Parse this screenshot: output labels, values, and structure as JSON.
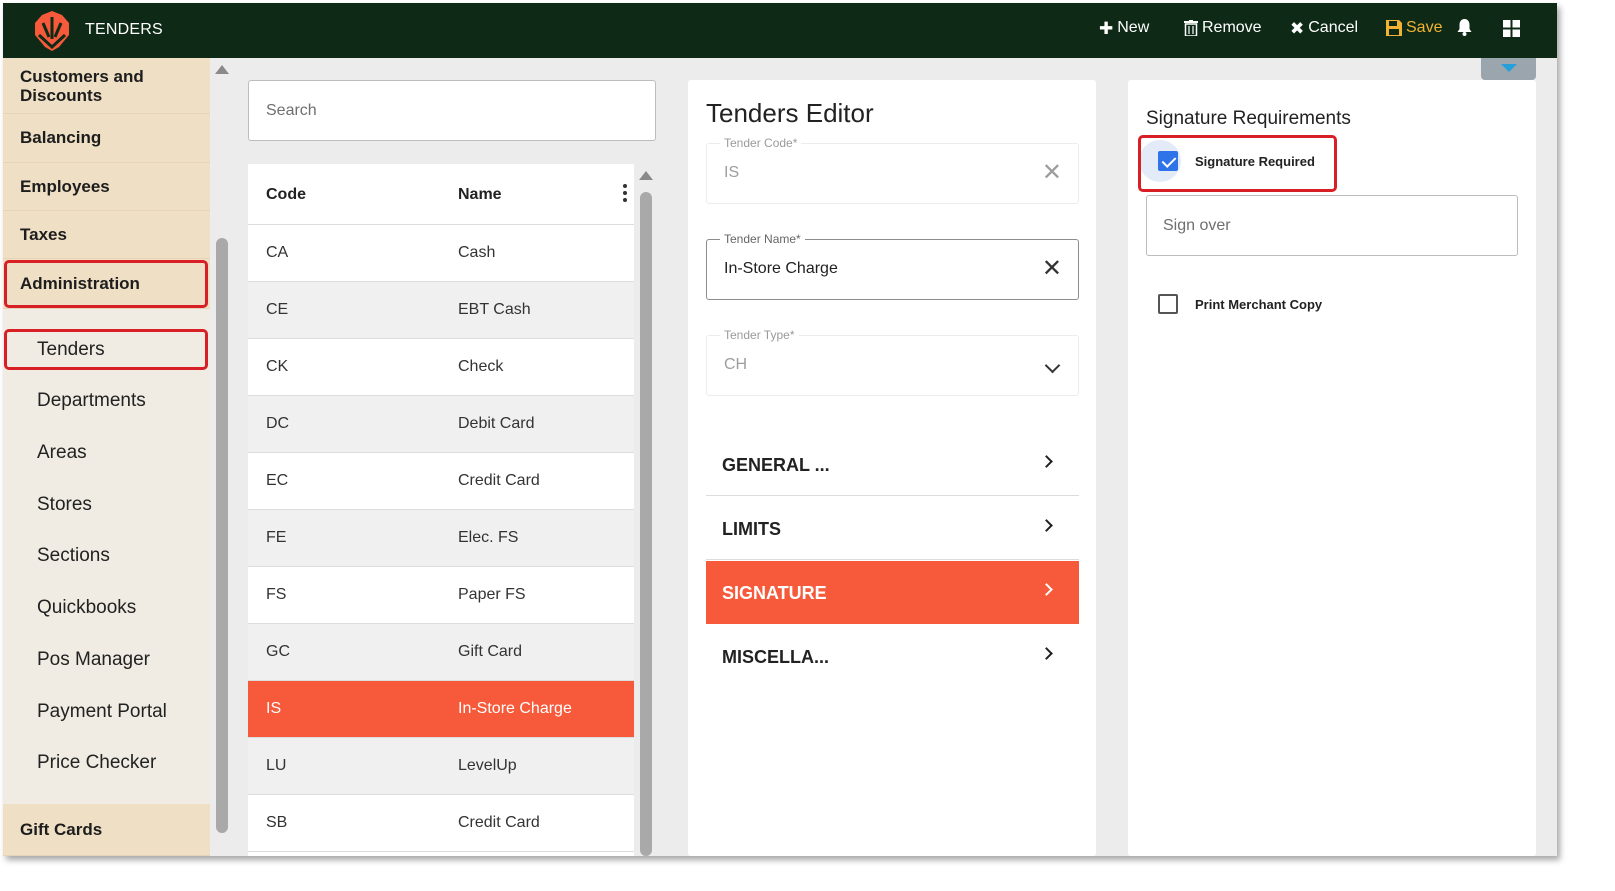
{
  "app": {
    "title": "TENDERS"
  },
  "toolbar": {
    "new_label": "New",
    "remove_label": "Remove",
    "cancel_label": "Cancel",
    "save_label": "Save",
    "icons": {
      "new": "plus-icon",
      "remove": "trash-icon",
      "cancel": "close-icon",
      "save": "save-icon",
      "notifications": "bell-icon",
      "apps": "grid-icon"
    },
    "colors": {
      "bar": "#0e2a16",
      "save": "#f2b233"
    }
  },
  "sidebar": {
    "sections": [
      {
        "label": "Customers and Discounts"
      },
      {
        "label": "Balancing"
      },
      {
        "label": "Employees"
      },
      {
        "label": "Taxes"
      },
      {
        "label": "Administration"
      }
    ],
    "items": [
      {
        "label": "Tenders"
      },
      {
        "label": "Departments"
      },
      {
        "label": "Areas"
      },
      {
        "label": "Stores"
      },
      {
        "label": "Sections"
      },
      {
        "label": "Quickbooks"
      },
      {
        "label": "Pos Manager"
      },
      {
        "label": "Payment Portal"
      },
      {
        "label": "Price Checker"
      }
    ],
    "footer_section": {
      "label": "Gift Cards"
    }
  },
  "list": {
    "search_placeholder": "Search",
    "columns": {
      "code": "Code",
      "name": "Name"
    },
    "rows": [
      {
        "code": "CA",
        "name": "Cash"
      },
      {
        "code": "CE",
        "name": "EBT Cash"
      },
      {
        "code": "CK",
        "name": "Check"
      },
      {
        "code": "DC",
        "name": "Debit Card"
      },
      {
        "code": "EC",
        "name": "Credit Card"
      },
      {
        "code": "FE",
        "name": "Elec. FS"
      },
      {
        "code": "FS",
        "name": "Paper FS"
      },
      {
        "code": "GC",
        "name": "Gift Card"
      },
      {
        "code": "IS",
        "name": "In-Store Charge"
      },
      {
        "code": "LU",
        "name": "LevelUp"
      },
      {
        "code": "SB",
        "name": "Credit Card"
      }
    ],
    "selected_code": "IS"
  },
  "editor": {
    "title": "Tenders Editor",
    "tender_code": {
      "label": "Tender Code*",
      "value": "IS"
    },
    "tender_name": {
      "label": "Tender Name*",
      "value": "In-Store Charge"
    },
    "tender_type": {
      "label": "Tender Type*",
      "value": "CH"
    },
    "sections": [
      {
        "label": "GENERAL ..."
      },
      {
        "label": "LIMITS"
      },
      {
        "label": "SIGNATURE"
      },
      {
        "label": "MISCELLA..."
      }
    ],
    "active_section": "SIGNATURE",
    "accent_color": "#f75a3a"
  },
  "signature": {
    "title": "Signature Requirements",
    "signature_required": {
      "label": "Signature Required",
      "checked": true
    },
    "sign_over_placeholder": "Sign over",
    "print_merchant_copy": {
      "label": "Print Merchant Copy",
      "checked": false
    }
  }
}
